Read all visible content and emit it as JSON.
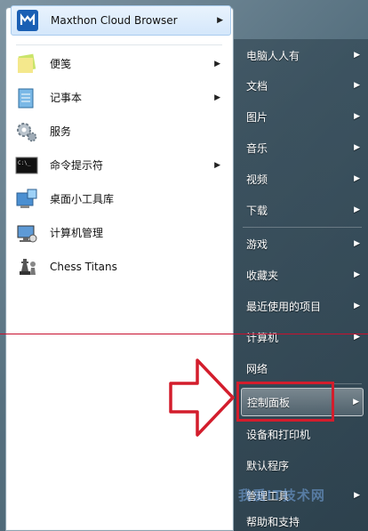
{
  "left_menu": {
    "pinned": {
      "label": "Maxthon Cloud Browser",
      "icon": "maxthon-icon",
      "has_submenu": true
    },
    "items": [
      {
        "label": "便笺",
        "icon": "sticky-notes-icon",
        "has_submenu": true
      },
      {
        "label": "记事本",
        "icon": "notepad-icon",
        "has_submenu": true
      },
      {
        "label": "服务",
        "icon": "services-gear-icon",
        "has_submenu": false
      },
      {
        "label": "命令提示符",
        "icon": "command-prompt-icon",
        "has_submenu": true
      },
      {
        "label": "桌面小工具库",
        "icon": "desktop-gadgets-icon",
        "has_submenu": false
      },
      {
        "label": "计算机管理",
        "icon": "computer-management-icon",
        "has_submenu": false
      },
      {
        "label": "Chess Titans",
        "icon": "chess-icon",
        "has_submenu": false
      }
    ]
  },
  "right_menu": {
    "items": [
      {
        "label": "电脑人人有",
        "has_submenu": true
      },
      {
        "label": "文档",
        "has_submenu": true
      },
      {
        "label": "图片",
        "has_submenu": true
      },
      {
        "label": "音乐",
        "has_submenu": true
      },
      {
        "label": "视频",
        "has_submenu": true
      },
      {
        "label": "下载",
        "has_submenu": true
      },
      {
        "label": "游戏",
        "has_submenu": true
      },
      {
        "label": "收藏夹",
        "has_submenu": true
      },
      {
        "label": "最近使用的项目",
        "has_submenu": true
      },
      {
        "label": "计算机",
        "has_submenu": true
      },
      {
        "label": "网络",
        "has_submenu": false
      },
      {
        "label": "控制面板",
        "has_submenu": true,
        "highlighted": true
      },
      {
        "label": "设备和打印机",
        "has_submenu": false
      },
      {
        "label": "默认程序",
        "has_submenu": false
      },
      {
        "label": "管理工具",
        "has_submenu": true
      },
      {
        "label": "帮助和支持",
        "has_submenu": false
      }
    ]
  },
  "annotation": {
    "color": "#d31d2c",
    "arrow_icon": "outline-arrow-icon"
  },
  "watermark": "我爱IT技术网"
}
